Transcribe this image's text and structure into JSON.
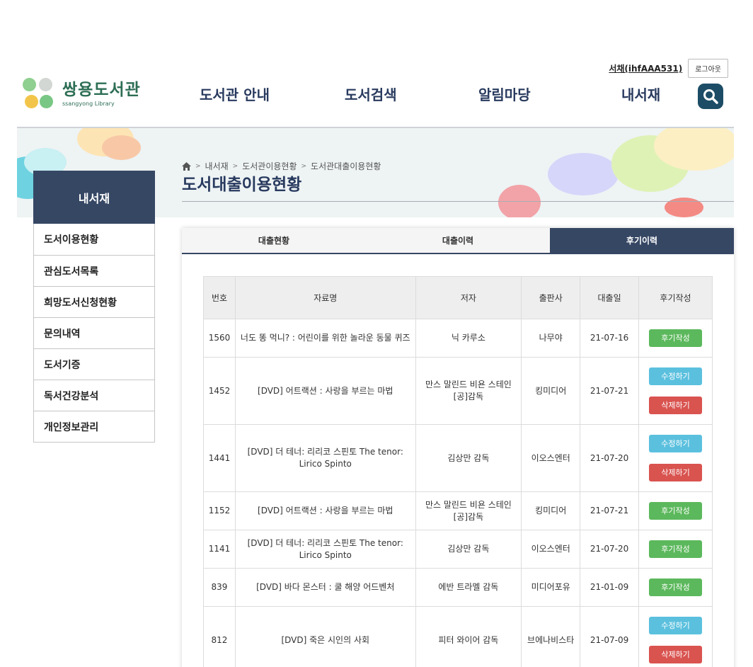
{
  "header": {
    "user_label": "서채(ihfAAA531)",
    "logout_label": "로그아웃",
    "logo_name": "쌍용도서관",
    "logo_sub": "ssangyong Library",
    "nav": [
      "도서관 안내",
      "도서검색",
      "알림마당",
      "내서재"
    ]
  },
  "breadcrumb": [
    "내서재",
    "도서관이용현황",
    "도서관대출이용현황"
  ],
  "page_title": "도서대출이용현황",
  "sidebar": {
    "title": "내서재",
    "items": [
      "도서이용현황",
      "관심도서목록",
      "희망도서신청현황",
      "문의내역",
      "도서기증",
      "독서건강분석",
      "개인정보관리"
    ]
  },
  "tabs": [
    "대출현황",
    "대출이력",
    "후기이력"
  ],
  "table": {
    "columns": [
      "번호",
      "자료명",
      "저자",
      "출판사",
      "대출일",
      "후기작성"
    ],
    "rows": [
      {
        "no": "1560",
        "title": "너도 똥 먹니? : 어린이를 위한 놀라운 동물 퀴즈",
        "author": "닉 카루소",
        "publisher": "나무야",
        "date": "21-07-16",
        "actions": [
          "후기작성"
        ]
      },
      {
        "no": "1452",
        "title": "[DVD] 어트랙션 : 사랑을 부르는 마법",
        "author": "만스 말린드 비욘 스테인 [공]감독",
        "publisher": "킹미디어",
        "date": "21-07-21",
        "actions": [
          "수정하기",
          "삭제하기"
        ]
      },
      {
        "no": "1441",
        "title": "[DVD] 더 테너: 리리코 스핀토 The tenor: Lirico Spinto",
        "author": "김상만 감독",
        "publisher": "이오스엔터",
        "date": "21-07-20",
        "actions": [
          "수정하기",
          "삭제하기"
        ]
      },
      {
        "no": "1152",
        "title": "[DVD] 어트랙션 : 사랑을 부르는 마법",
        "author": "만스 말린드 비욘 스테인 [공]감독",
        "publisher": "킹미디어",
        "date": "21-07-21",
        "actions": [
          "후기작성"
        ]
      },
      {
        "no": "1141",
        "title": "[DVD] 더 테너: 리리코 스핀토 The tenor: Lirico Spinto",
        "author": "김상만 감독",
        "publisher": "이오스엔터",
        "date": "21-07-20",
        "actions": [
          "후기작성"
        ]
      },
      {
        "no": "839",
        "title": "[DVD] 바다 몬스터 : 쿨 해양 어드벤처",
        "author": "에반 트라멜 감독",
        "publisher": "미디어포유",
        "date": "21-01-09",
        "actions": [
          "후기작성"
        ]
      },
      {
        "no": "812",
        "title": "[DVD] 죽은 시인의 사회",
        "author": "피터 와이어 감독",
        "publisher": "브에나비스타",
        "date": "21-07-09",
        "actions": [
          "수정하기",
          "삭제하기"
        ]
      }
    ]
  }
}
